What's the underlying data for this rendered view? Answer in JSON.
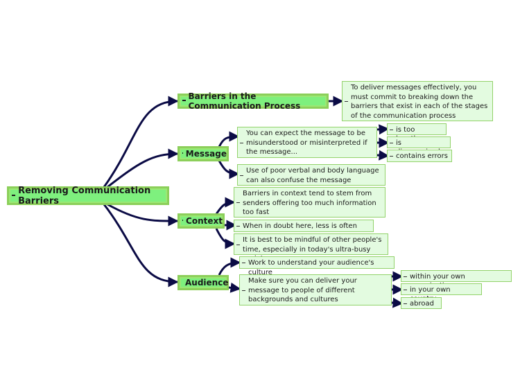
{
  "colors": {
    "connector": "#0b0b45",
    "main_fill": "#7ef07e",
    "main_border": "#8ccf5a",
    "leaf_fill": "#e3fbe0",
    "leaf_border": "#92d26a"
  },
  "root": {
    "label": "Removing Communication Barriers",
    "toggle_icon": "collapse-minus-icon"
  },
  "branches": [
    {
      "label": "Barriers in the Communication Process",
      "children": [
        {
          "text": "To deliver messages effectively, you must commit to breaking down the barriers that exist in each of the stages of the communication process"
        }
      ]
    },
    {
      "label": "Message",
      "children": [
        {
          "text": "You can expect the message to be misunderstood or misinterpreted if the message...",
          "children": [
            "is too lengthy",
            "is disorganised",
            "contains errors"
          ]
        },
        {
          "text": "Use of poor verbal and body language can also confuse the message"
        }
      ]
    },
    {
      "label": "Context",
      "children": [
        {
          "text": "Barriers in context tend to stem from senders offering too much information too fast"
        },
        {
          "text": "When in doubt here, less is often more"
        },
        {
          "text": "It is best to be mindful of other people's time, especially in today's ultra-busy society"
        }
      ]
    },
    {
      "label": "Audience",
      "children": [
        {
          "text": "Work to understand your audience's culture"
        },
        {
          "text": "Make sure you can deliver your message to people of different backgrounds and cultures",
          "children": [
            "within your own organisation",
            "in your own country",
            "abroad"
          ]
        }
      ]
    }
  ]
}
